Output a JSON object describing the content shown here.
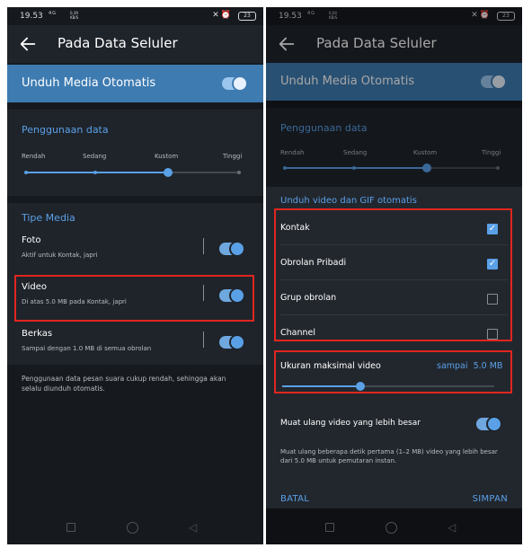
{
  "status": {
    "left": {
      "time": "19.53",
      "network": "4G",
      "speed_value": "0,39",
      "speed_unit": "KB/S",
      "battery": "23"
    },
    "right": {
      "time": "19.53",
      "network": "4G",
      "speed_value": "0,04",
      "speed_unit": "KB/S",
      "battery": "23"
    }
  },
  "appbar": {
    "title": "Pada Data Seluler"
  },
  "auto_download": {
    "label": "Unduh Media Otomatis"
  },
  "data_usage": {
    "heading": "Penggunaan data",
    "levels": [
      "Rendah",
      "Sedang",
      "Kustom",
      "Tinggi"
    ],
    "selected_level": "Kustom"
  },
  "media_types": {
    "heading": "Tipe Media",
    "items": [
      {
        "title": "Foto",
        "subtitle": "Aktif untuk Kontak, japri"
      },
      {
        "title": "Video",
        "subtitle": "Di atas 5.0 MB pada Kontak, japri"
      },
      {
        "title": "Berkas",
        "subtitle": "Sampai dengan 1.0 MB di semua obrolan"
      }
    ],
    "note": "Penggunaan data pesan suara cukup rendah, sehingga akan selalu diunduh otomatis."
  },
  "dialog": {
    "title": "Unduh video dan GIF otomatis",
    "options": [
      {
        "label": "Kontak",
        "checked": true
      },
      {
        "label": "Obrolan Pribadi",
        "checked": true
      },
      {
        "label": "Grup obrolan",
        "checked": false
      },
      {
        "label": "Channel",
        "checked": false
      }
    ],
    "max_size": {
      "label": "Ukuran maksimal video",
      "value_prefix": "sampai",
      "value": "5.0 MB",
      "fraction": 0.37
    },
    "preload": {
      "label": "Muat ulang video yang lebih besar",
      "description": "Muat ulang beberapa detik pertama (1–2 MB) video yang lebih besar dari 5.0 MB untuk pemutaran instan."
    },
    "cancel": "BATAL",
    "save": "SIMPAN",
    "check_glyph": "✓"
  },
  "icons": {
    "back": "arrow-left-icon",
    "status": [
      "vibrate-icon",
      "alarm-icon",
      "battery-icon"
    ],
    "nav": [
      "recent-apps-icon",
      "home-icon",
      "back-triangle-icon"
    ]
  },
  "colors": {
    "accent": "#5aa0e6",
    "banner": "#3e7bb1",
    "background": "#161a1f",
    "card": "#1f242b",
    "highlight": "#e0261f"
  }
}
